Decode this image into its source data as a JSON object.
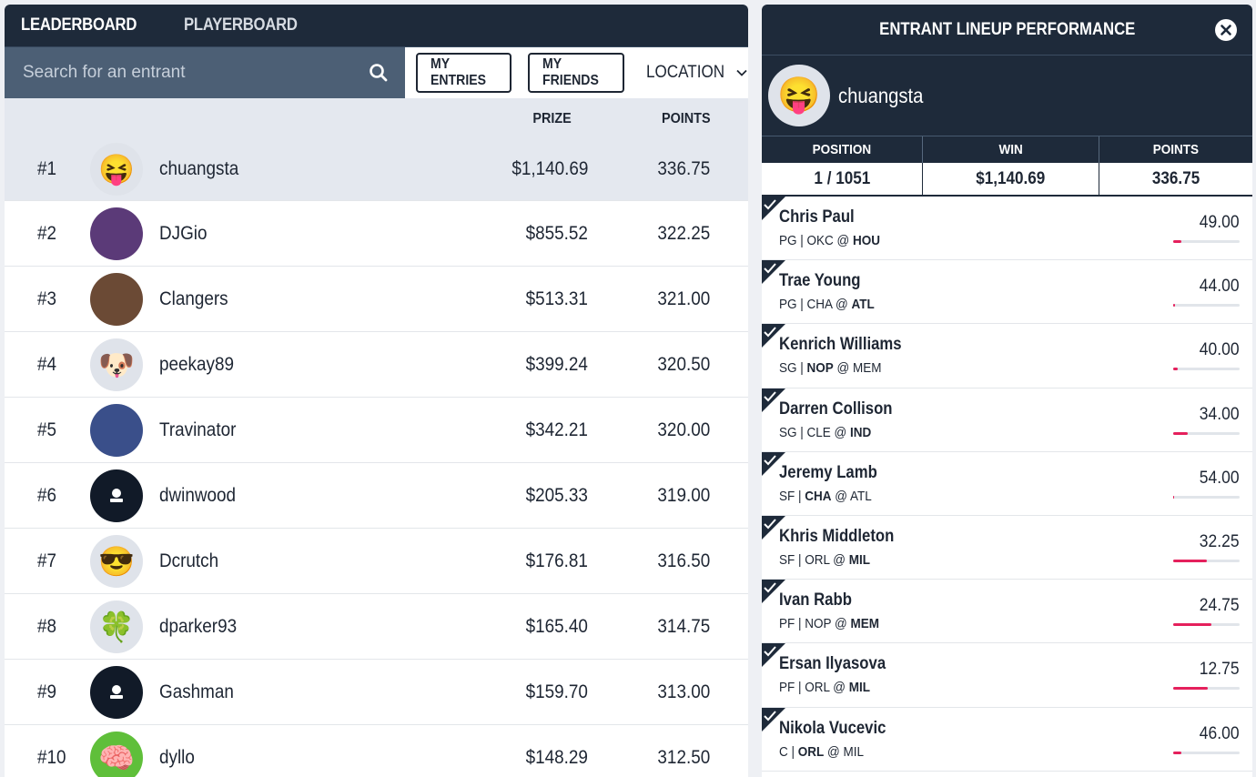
{
  "tabs": {
    "leaderboard": "LEADERBOARD",
    "playerboard": "PLAYERBOARD"
  },
  "filter": {
    "search_placeholder": "Search for an entrant",
    "my_entries": "MY ENTRIES",
    "my_friends": "MY FRIENDS",
    "location": "LOCATION"
  },
  "columns": {
    "prize": "PRIZE",
    "points": "POINTS"
  },
  "entrants": [
    {
      "rank": "#1",
      "avatar": "😝",
      "avatar_bg": "#dfe3ea",
      "name": "chuangsta",
      "prize": "$1,140.69",
      "points": "336.75",
      "highlight": true
    },
    {
      "rank": "#2",
      "avatar": "",
      "avatar_bg": "#5b3a78",
      "name": "DJGio",
      "prize": "$855.52",
      "points": "322.25"
    },
    {
      "rank": "#3",
      "avatar": "",
      "avatar_bg": "#6b4a35",
      "name": "Clangers",
      "prize": "$513.31",
      "points": "321.00"
    },
    {
      "rank": "#4",
      "avatar": "🐶",
      "avatar_bg": "#dfe3ea",
      "name": "peekay89",
      "prize": "$399.24",
      "points": "320.50"
    },
    {
      "rank": "#5",
      "avatar": "",
      "avatar_bg": "#3a4f8a",
      "name": "Travinator",
      "prize": "$342.21",
      "points": "320.00"
    },
    {
      "rank": "#6",
      "avatar": "",
      "avatar_bg": "#111a28",
      "name": "dwinwood",
      "prize": "$205.33",
      "points": "319.00",
      "default_avatar": true
    },
    {
      "rank": "#7",
      "avatar": "😎",
      "avatar_bg": "#dfe3ea",
      "name": "Dcrutch",
      "prize": "$176.81",
      "points": "316.50"
    },
    {
      "rank": "#8",
      "avatar": "🍀",
      "avatar_bg": "#dfe3ea",
      "name": "dparker93",
      "prize": "$165.40",
      "points": "314.75"
    },
    {
      "rank": "#9",
      "avatar": "",
      "avatar_bg": "#111a28",
      "name": "Gashman",
      "prize": "$159.70",
      "points": "313.00",
      "default_avatar": true
    },
    {
      "rank": "#10",
      "avatar": "🧠",
      "avatar_bg": "#5fbf3a",
      "name": "dyllo",
      "prize": "$148.29",
      "points": "312.50"
    }
  ],
  "panel": {
    "title": "ENTRANT LINEUP PERFORMANCE",
    "user": {
      "avatar": "😝",
      "name": "chuangsta"
    },
    "stats_headers": {
      "position": "POSITION",
      "win": "WIN",
      "points": "POINTS"
    },
    "stats_values": {
      "position": "1 / 1051",
      "win": "$1,140.69",
      "points": "336.75"
    },
    "players": [
      {
        "name": "Chris Paul",
        "pos": "PG",
        "team": "OKC",
        "opp": "HOU",
        "bold": "opp",
        "score": "49.00",
        "ownership": 0.12
      },
      {
        "name": "Trae Young",
        "pos": "PG",
        "team": "CHA",
        "opp": "ATL",
        "bold": "opp",
        "score": "44.00",
        "ownership": 0.03
      },
      {
        "name": "Kenrich Williams",
        "pos": "SG",
        "team": "NOP",
        "opp": "MEM",
        "bold": "team",
        "score": "40.00",
        "ownership": 0.07
      },
      {
        "name": "Darren Collison",
        "pos": "SG",
        "team": "CLE",
        "opp": "IND",
        "bold": "opp",
        "score": "34.00",
        "ownership": 0.22
      },
      {
        "name": "Jeremy Lamb",
        "pos": "SF",
        "team": "CHA",
        "opp": "ATL",
        "bold": "team",
        "score": "54.00",
        "ownership": 0.02
      },
      {
        "name": "Khris Middleton",
        "pos": "SF",
        "team": "ORL",
        "opp": "MIL",
        "bold": "opp",
        "score": "32.25",
        "ownership": 0.5
      },
      {
        "name": "Ivan Rabb",
        "pos": "PF",
        "team": "NOP",
        "opp": "MEM",
        "bold": "opp",
        "score": "24.75",
        "ownership": 0.58
      },
      {
        "name": "Ersan Ilyasova",
        "pos": "PF",
        "team": "ORL",
        "opp": "MIL",
        "bold": "opp",
        "score": "12.75",
        "ownership": 0.52
      },
      {
        "name": "Nikola Vucevic",
        "pos": "C",
        "team": "ORL",
        "opp": "MIL",
        "bold": "team",
        "score": "46.00",
        "ownership": 0.12
      }
    ]
  },
  "colors": {
    "navy": "#1e2a3a",
    "search_bg": "#4c5f75",
    "accent_bar": "#e5205c",
    "highlight_row": "#e4e8ef"
  }
}
